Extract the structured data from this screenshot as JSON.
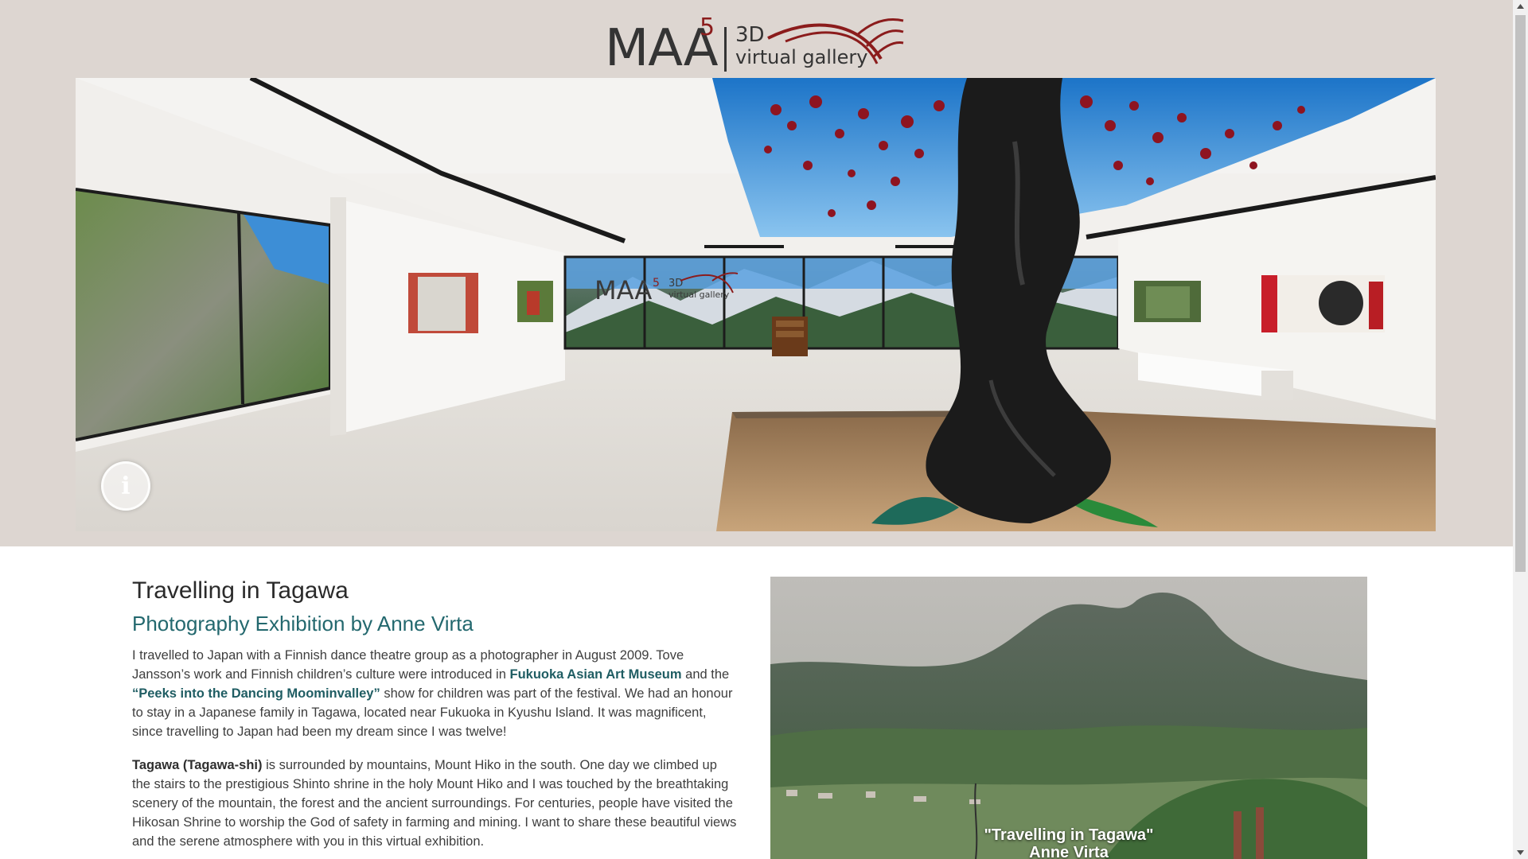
{
  "logo": {
    "brand": "MAA",
    "superscript": "5",
    "line1": "3D",
    "line2": "virtual gallery",
    "accent": "#8b1c1c"
  },
  "viewport": {
    "wall_sign_brand": "MAA",
    "wall_sign_superscript": "5",
    "wall_sign_3d": "3D",
    "wall_sign_vg": "virtual gallery",
    "info_button_label": "i"
  },
  "content": {
    "title": "Travelling in Tagawa",
    "subtitle": "Photography Exhibition by Anne Virta",
    "p1": {
      "t1": "I travelled to Japan with a Finnish dance theatre group as a photographer in August 2009. Tove Jansson’s work and Finnish children’s culture were introduced in ",
      "link1": "Fukuoka Asian Art Museum",
      "t2": " and the ",
      "link2": "“Peeks into the Dancing Moominvalley”",
      "t3": " show for children was part of the festival. We had an honour to stay in a Japanese family in Tagawa, located near Fukuoka in Kyushu Island. It was magnificent, since travelling to Japan had been my dream since I was twelve!"
    },
    "p2": {
      "bold": "Tagawa (Tagawa-shi)",
      "text": " is surrounded by mountains, Mount Hiko in the south. One day we climbed up the stairs to the prestigious Shinto shrine in the holy Mount Hiko and I was touched by the breathtaking scenery of the mountain, the forest and the ancient surroundings. For centuries, people have visited the Hikosan Shrine to worship the God of safety in farming and mining. I want to share these beautiful views and the serene atmosphere with you in this virtual exhibition."
    }
  },
  "feature": {
    "caption_line1": "\"Travelling in Tagawa\"",
    "caption_line2": "Anne Virta"
  },
  "colors": {
    "header_bg": "#ddd6d1",
    "accent_teal": "#23686e",
    "sky": "#2a8ad8",
    "leaf_red": "#8e1420"
  }
}
